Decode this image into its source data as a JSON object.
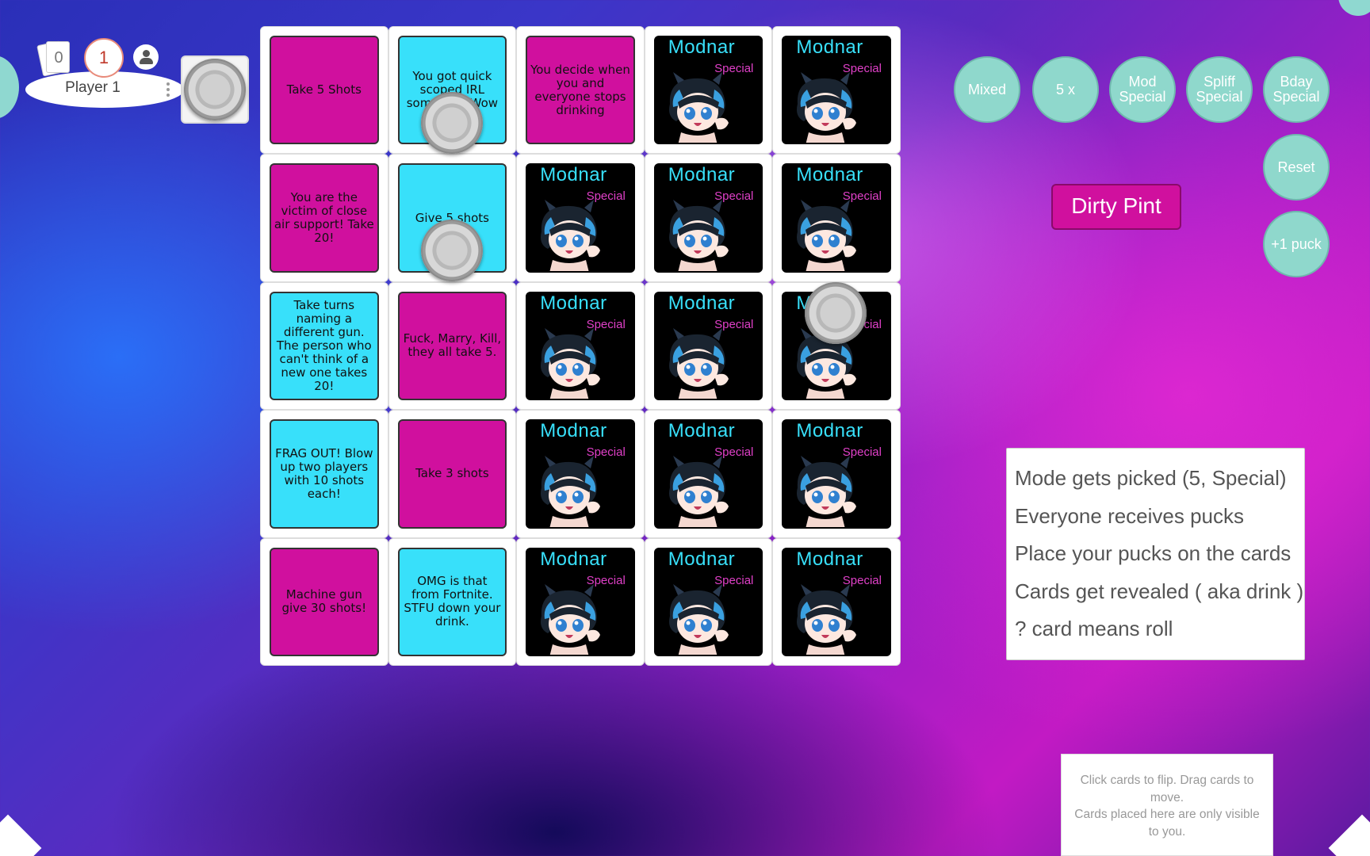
{
  "player": {
    "name": "Player 1",
    "cards_in_hand": "0",
    "score": "1"
  },
  "board": {
    "cards": [
      {
        "type": "magenta",
        "text": "Take 5 Shots"
      },
      {
        "type": "cyan",
        "text": "You got quick scoped IRL somehow. Wow"
      },
      {
        "type": "magenta",
        "text": "You decide when you and everyone stops drinking"
      },
      {
        "type": "modnar"
      },
      {
        "type": "modnar"
      },
      {
        "type": "magenta",
        "text": "You are the victim of close air support! Take 20!"
      },
      {
        "type": "cyan",
        "text": "Give 5 shots"
      },
      {
        "type": "modnar"
      },
      {
        "type": "modnar"
      },
      {
        "type": "modnar"
      },
      {
        "type": "cyan",
        "text": "Take turns naming a different gun. The person who can't think of a new one takes 20!"
      },
      {
        "type": "magenta",
        "text": "Fuck, Marry, Kill, they all take 5."
      },
      {
        "type": "modnar"
      },
      {
        "type": "modnar"
      },
      {
        "type": "modnar"
      },
      {
        "type": "cyan",
        "text": "FRAG OUT! Blow up two players with 10 shots each!"
      },
      {
        "type": "magenta",
        "text": "Take 3 shots"
      },
      {
        "type": "modnar"
      },
      {
        "type": "modnar"
      },
      {
        "type": "modnar"
      },
      {
        "type": "magenta",
        "text": "Machine gun give 30 shots!"
      },
      {
        "type": "cyan",
        "text": "OMG is that from Fortnite. STFU down your drink."
      },
      {
        "type": "modnar"
      },
      {
        "type": "modnar"
      },
      {
        "type": "modnar"
      }
    ],
    "modnar_title": "Modnar",
    "modnar_subtitle": "Special"
  },
  "modes": {
    "mixed": "Mixed",
    "five_x": "5 x",
    "mod_special": "Mod Special",
    "spliff_special": "Spliff Special",
    "bday_special": "Bday Special",
    "reset": "Reset",
    "plus_puck": "+1 puck"
  },
  "game_name": "Dirty Pint",
  "rules": [
    "Mode gets picked (5, Special)",
    "Everyone receives pucks",
    "Place your pucks on the cards",
    "Cards get revealed ( aka drink )",
    " ? card means roll"
  ],
  "hint": {
    "line1": "Click cards to flip.   Drag cards to move.",
    "line2": "Cards placed here are only visible to you."
  },
  "colors": {
    "magenta_card": "#d0109e",
    "cyan_card": "#38e0fa",
    "mode_button": "#8fd8cc",
    "modnar_title": "#38e0fa",
    "modnar_subtitle": "#e040c8"
  }
}
